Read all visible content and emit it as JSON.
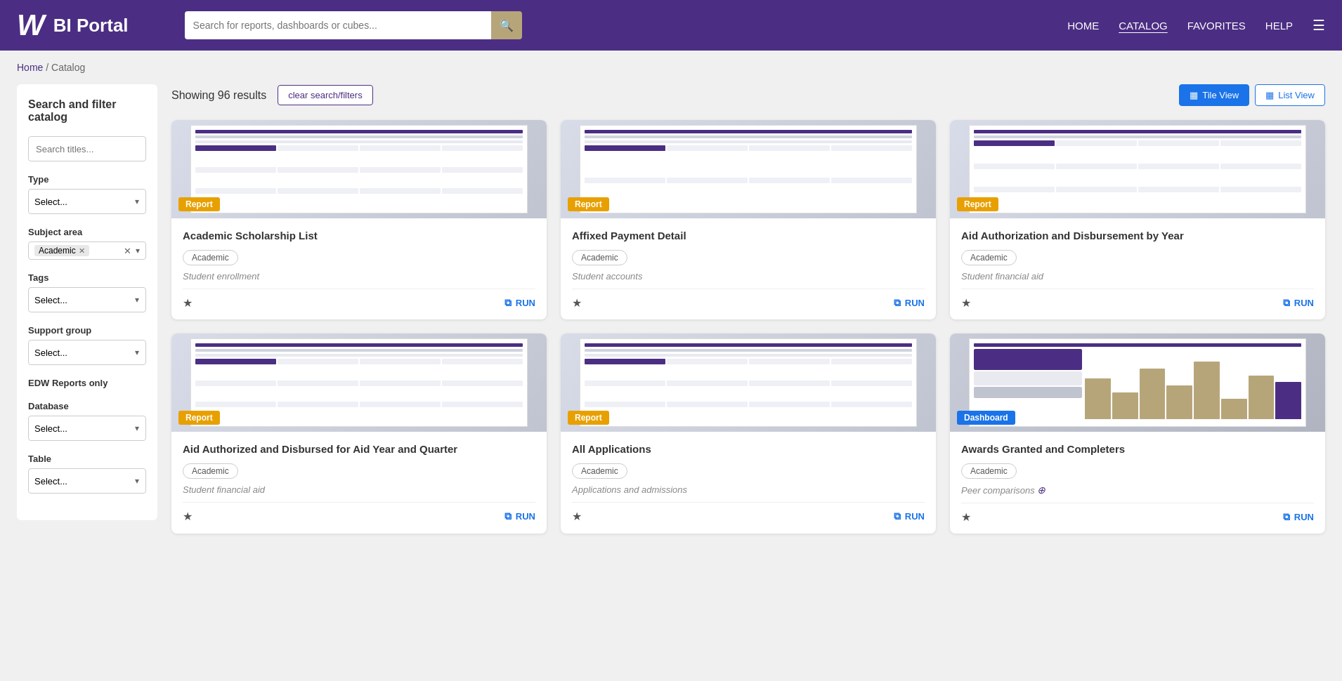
{
  "header": {
    "logo_letter": "W",
    "logo_title": "BI Portal",
    "search_placeholder": "Search for reports, dashboards or cubes...",
    "nav_items": [
      {
        "label": "HOME",
        "active": false
      },
      {
        "label": "CATALOG",
        "active": true
      },
      {
        "label": "FAVORITES",
        "active": false
      },
      {
        "label": "HELP",
        "active": false
      }
    ]
  },
  "breadcrumb": {
    "home_label": "Home",
    "separator": "/",
    "current": "Catalog"
  },
  "sidebar": {
    "title": "Search and filter catalog",
    "search_placeholder": "Search titles...",
    "filters": [
      {
        "id": "type",
        "label": "Type",
        "placeholder": "Select..."
      },
      {
        "id": "subject_area",
        "label": "Subject area",
        "value": "Academic"
      },
      {
        "id": "tags",
        "label": "Tags",
        "placeholder": "Select..."
      },
      {
        "id": "support_group",
        "label": "Support group",
        "placeholder": "Select..."
      },
      {
        "id": "edw_reports",
        "label": "EDW Reports only"
      },
      {
        "id": "database",
        "label": "Database",
        "placeholder": "Select..."
      },
      {
        "id": "table",
        "label": "Table",
        "placeholder": "Select..."
      }
    ]
  },
  "content": {
    "results_count": "Showing 96 results",
    "clear_btn": "clear search/filters",
    "tile_view_label": "Tile View",
    "list_view_label": "List View",
    "cards": [
      {
        "id": 1,
        "type": "Report",
        "type_class": "badge-report",
        "title": "Academic Scholarship List",
        "subject": "Academic",
        "description": "Student enrollment",
        "preview_type": "table"
      },
      {
        "id": 2,
        "type": "Report",
        "type_class": "badge-report",
        "title": "Affixed Payment Detail",
        "subject": "Academic",
        "description": "Student accounts",
        "preview_type": "table"
      },
      {
        "id": 3,
        "type": "Report",
        "type_class": "badge-report",
        "title": "Aid Authorization and Disbursement by Year",
        "subject": "Academic",
        "description": "Student financial aid",
        "preview_type": "table"
      },
      {
        "id": 4,
        "type": "Report",
        "type_class": "badge-report",
        "title": "Aid Authorized and Disbursed for Aid Year and Quarter",
        "subject": "Academic",
        "description": "Student financial aid",
        "preview_type": "table"
      },
      {
        "id": 5,
        "type": "Report",
        "type_class": "badge-report",
        "title": "All Applications",
        "subject": "Academic",
        "description": "Applications and admissions",
        "preview_type": "table"
      },
      {
        "id": 6,
        "type": "Dashboard",
        "type_class": "badge-dashboard",
        "title": "Awards Granted and Completers",
        "subject": "Academic",
        "description": "Peer comparisons",
        "description_extra": true,
        "preview_type": "dashboard"
      }
    ]
  }
}
